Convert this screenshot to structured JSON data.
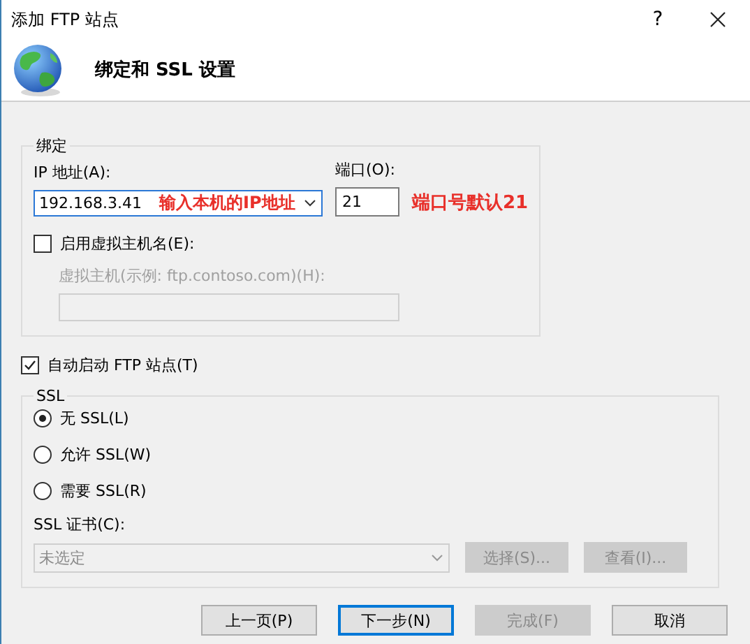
{
  "window": {
    "title": "添加 FTP 站点",
    "help": "?"
  },
  "header": {
    "title": "绑定和 SSL 设置"
  },
  "binding": {
    "legend": "绑定",
    "ip_label": "IP 地址(A):",
    "ip_value": "192.168.3.41",
    "ip_note": "输入本机的IP地址",
    "port_label": "端口(O):",
    "port_value": "21",
    "port_note": "端口号默认21",
    "virtual_host": {
      "label": "启用虚拟主机名(E):",
      "checked": false
    },
    "host_label": "虚拟主机(示例: ftp.contoso.com)(H):",
    "host_disabled": true
  },
  "auto_start": {
    "label": "自动启动 FTP 站点(T)",
    "checked": true
  },
  "ssl": {
    "legend": "SSL",
    "options": [
      {
        "label": "无 SSL(L)",
        "selected": true
      },
      {
        "label": "允许 SSL(W)",
        "selected": false
      },
      {
        "label": "需要 SSL(R)",
        "selected": false
      }
    ],
    "cert_label": "SSL 证书(C):",
    "cert_value": "未选定",
    "cert_disabled": true,
    "buttons": [
      {
        "label": "选择(S)...",
        "disabled": true
      },
      {
        "label": "查看(I)...",
        "disabled": true
      }
    ]
  },
  "buttons": [
    {
      "label": "上一页(P)",
      "disabled": false,
      "default": false
    },
    {
      "label": "下一步(N)",
      "disabled": false,
      "default": true
    },
    {
      "label": "完成(F)",
      "disabled": true,
      "default": false
    },
    {
      "label": "取消",
      "disabled": false,
      "default": false
    }
  ]
}
